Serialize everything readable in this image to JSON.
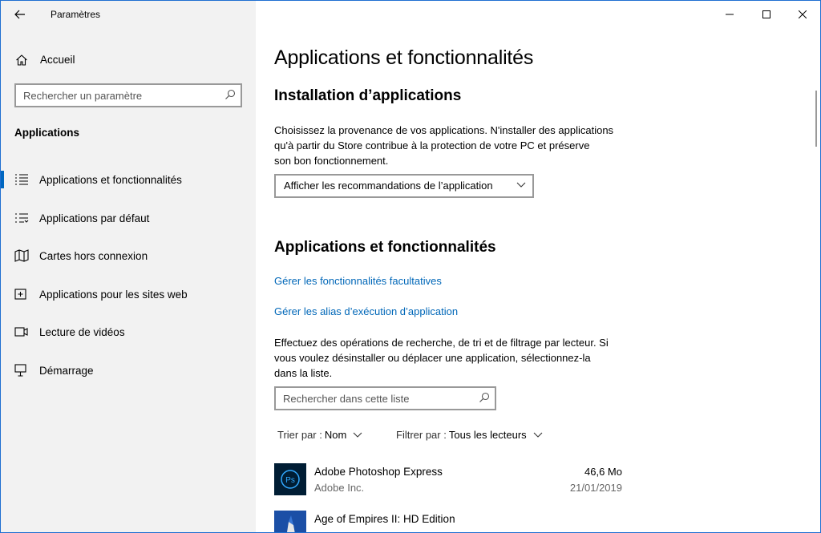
{
  "window": {
    "title": "Paramètres",
    "controls": [
      "minimize",
      "maximize",
      "close"
    ]
  },
  "sidebar": {
    "home_label": "Accueil",
    "search_placeholder": "Rechercher un paramètre",
    "section_heading": "Applications",
    "items": [
      {
        "label": "Applications et fonctionnalités",
        "icon": "apps-features-icon",
        "selected": true
      },
      {
        "label": "Applications par défaut",
        "icon": "default-apps-icon",
        "selected": false
      },
      {
        "label": "Cartes hors connexion",
        "icon": "offline-maps-icon",
        "selected": false
      },
      {
        "label": "Applications pour les sites web",
        "icon": "apps-for-websites-icon",
        "selected": false
      },
      {
        "label": "Lecture de vidéos",
        "icon": "video-playback-icon",
        "selected": false
      },
      {
        "label": "Démarrage",
        "icon": "startup-icon",
        "selected": false
      }
    ]
  },
  "main": {
    "page_title": "Applications et fonctionnalités",
    "install_heading": "Installation d’applications",
    "install_desc": "Choisissez la provenance de vos applications. N'installer des applications qu'à partir du Store contribue à la protection de votre PC et préserve son bon fonctionnement.",
    "install_desc_lines": [
      "Choisissez la provenance de vos applications. N'installer des applications",
      "qu'à partir du Store contribue à la protection de votre PC et préserve",
      "son bon fonctionnement."
    ],
    "install_dropdown_value": "Afficher les recommandations de l’application",
    "apps_heading": "Applications et fonctionnalités",
    "link_optional_features": "Gérer les fonctionnalités facultatives",
    "link_exec_aliases": "Gérer les alias d’exécution d’application",
    "search_desc_lines": [
      "Effectuez des opérations de recherche, de tri et de filtrage par lecteur. Si",
      "vous voulez désinstaller ou déplacer une application, sélectionnez-la",
      "dans la liste."
    ],
    "list_search_placeholder": "Rechercher dans cette liste",
    "sort_label": "Trier par :",
    "sort_value": "Nom",
    "filter_label": "Filtrer par :",
    "filter_value": "Tous les lecteurs",
    "apps": [
      {
        "name": "Adobe Photoshop Express",
        "publisher": "Adobe Inc.",
        "size": "46,6 Mo",
        "date": "21/01/2019",
        "tile_color": "#001d34",
        "accent": "#31a8ff"
      },
      {
        "name": "Age of Empires II: HD Edition",
        "publisher": "",
        "size": "",
        "date": "",
        "tile_color": "#1b4fa6",
        "accent": "#f0f0f0"
      }
    ]
  },
  "colors": {
    "accent": "#0067c0",
    "link": "#0067b8",
    "sidebar_bg": "#f2f2f2",
    "window_border": "#1f6fd1"
  }
}
